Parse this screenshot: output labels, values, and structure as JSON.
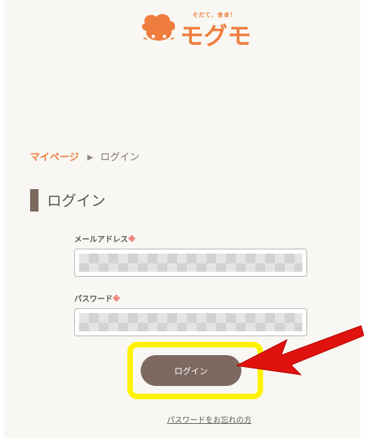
{
  "logo": {
    "tagline": "そだて、食卓！",
    "wordmark": "モグモ"
  },
  "breadcrumb": {
    "home_label": "マイページ",
    "current_label": "ログイン"
  },
  "heading": {
    "title": "ログイン"
  },
  "form": {
    "email_label": "メールアドレス",
    "password_label": "パスワード",
    "required_mark": "※",
    "email_value": "",
    "password_value": "",
    "submit_label": "ログイン"
  },
  "forgot_password_label": "パスワードをお忘れの方",
  "annotation": {
    "highlight_color": "#fff200",
    "arrow_color": "#e0120d"
  },
  "colors": {
    "brand_orange": "#ef7d3d",
    "button_brown": "#7d6960",
    "page_bg": "#f9f7f3"
  }
}
